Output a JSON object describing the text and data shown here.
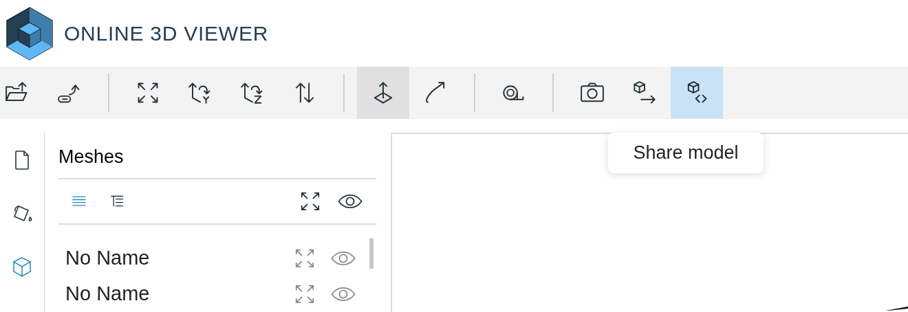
{
  "header": {
    "title": "ONLINE 3D VIEWER"
  },
  "toolbar": [
    [
      {
        "pressed": false,
        "hovered": false
      },
      {
        "pressed": false,
        "hovered": false
      }
    ],
    [
      {
        "pressed": false,
        "hovered": false
      },
      {
        "pressed": false,
        "hovered": false
      },
      {
        "pressed": false,
        "hovered": false
      },
      {
        "pressed": false,
        "hovered": false
      }
    ],
    [
      {
        "pressed": true,
        "hovered": false
      },
      {
        "pressed": false,
        "hovered": false
      }
    ],
    [
      {
        "pressed": false,
        "hovered": false
      }
    ],
    [
      {
        "pressed": false,
        "hovered": false
      },
      {
        "pressed": false,
        "hovered": false
      },
      {
        "pressed": false,
        "hovered": true
      }
    ]
  ],
  "tooltip": {
    "text": "Share model"
  },
  "sidebar_tabs": [
    {
      "selected": false
    },
    {
      "selected": false
    },
    {
      "selected": true
    }
  ],
  "panel": {
    "title": "Meshes",
    "view_modes": [
      {
        "selected": true
      },
      {
        "selected": false
      }
    ],
    "meshes": [
      {
        "name": "No Name"
      },
      {
        "name": "No Name"
      }
    ]
  }
}
